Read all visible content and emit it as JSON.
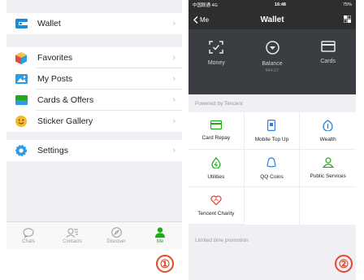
{
  "left_phone": {
    "menu": [
      {
        "label": "Wallet",
        "icon": "wallet-icon"
      },
      {
        "label": "Favorites",
        "icon": "favorites-cube-icon"
      },
      {
        "label": "My Posts",
        "icon": "photo-icon"
      },
      {
        "label": "Cards & Offers",
        "icon": "cards-offers-icon"
      },
      {
        "label": "Sticker Gallery",
        "icon": "smiley-icon"
      },
      {
        "label": "Settings",
        "icon": "settings-gear-icon"
      }
    ],
    "tabs": [
      {
        "label": "Chats",
        "icon": "chat-bubble-icon"
      },
      {
        "label": "Contacts",
        "icon": "contacts-icon"
      },
      {
        "label": "Discover",
        "icon": "compass-icon"
      },
      {
        "label": "Me",
        "icon": "person-icon",
        "active": true
      }
    ],
    "marker": "①"
  },
  "right_phone": {
    "status": {
      "carrier": "中国联通 4G",
      "time": "16:48",
      "battery": "75%"
    },
    "nav": {
      "back_label": "Me",
      "title": "Wallet"
    },
    "hero": [
      {
        "label": "Money",
        "icon": "scan-money-icon",
        "sub": ""
      },
      {
        "label": "Balance",
        "icon": "balance-icon",
        "sub": "¥44.07"
      },
      {
        "label": "Cards",
        "icon": "card-icon",
        "sub": ""
      }
    ],
    "powered_by": "Powered by Tencent",
    "services": [
      {
        "label": "Card Repay",
        "icon": "card-repay-icon"
      },
      {
        "label": "Mobile Top Up",
        "icon": "mobile-topup-icon"
      },
      {
        "label": "Wealth",
        "icon": "wealth-icon"
      },
      {
        "label": "Utilities",
        "icon": "utilities-icon"
      },
      {
        "label": "QQ Coins",
        "icon": "qq-coins-icon"
      },
      {
        "label": "Public Services",
        "icon": "public-services-icon"
      },
      {
        "label": "Tencent Charity",
        "icon": "charity-heart-icon"
      }
    ],
    "promotion": "Limited time promotion",
    "marker": "②"
  },
  "colors": {
    "accent_green": "#1aad19",
    "nav_dark": "#2e2e2e",
    "hero_dark": "#3a3d42",
    "marker_red": "#e24a2a",
    "icon_blue": "#1a8bd6"
  }
}
